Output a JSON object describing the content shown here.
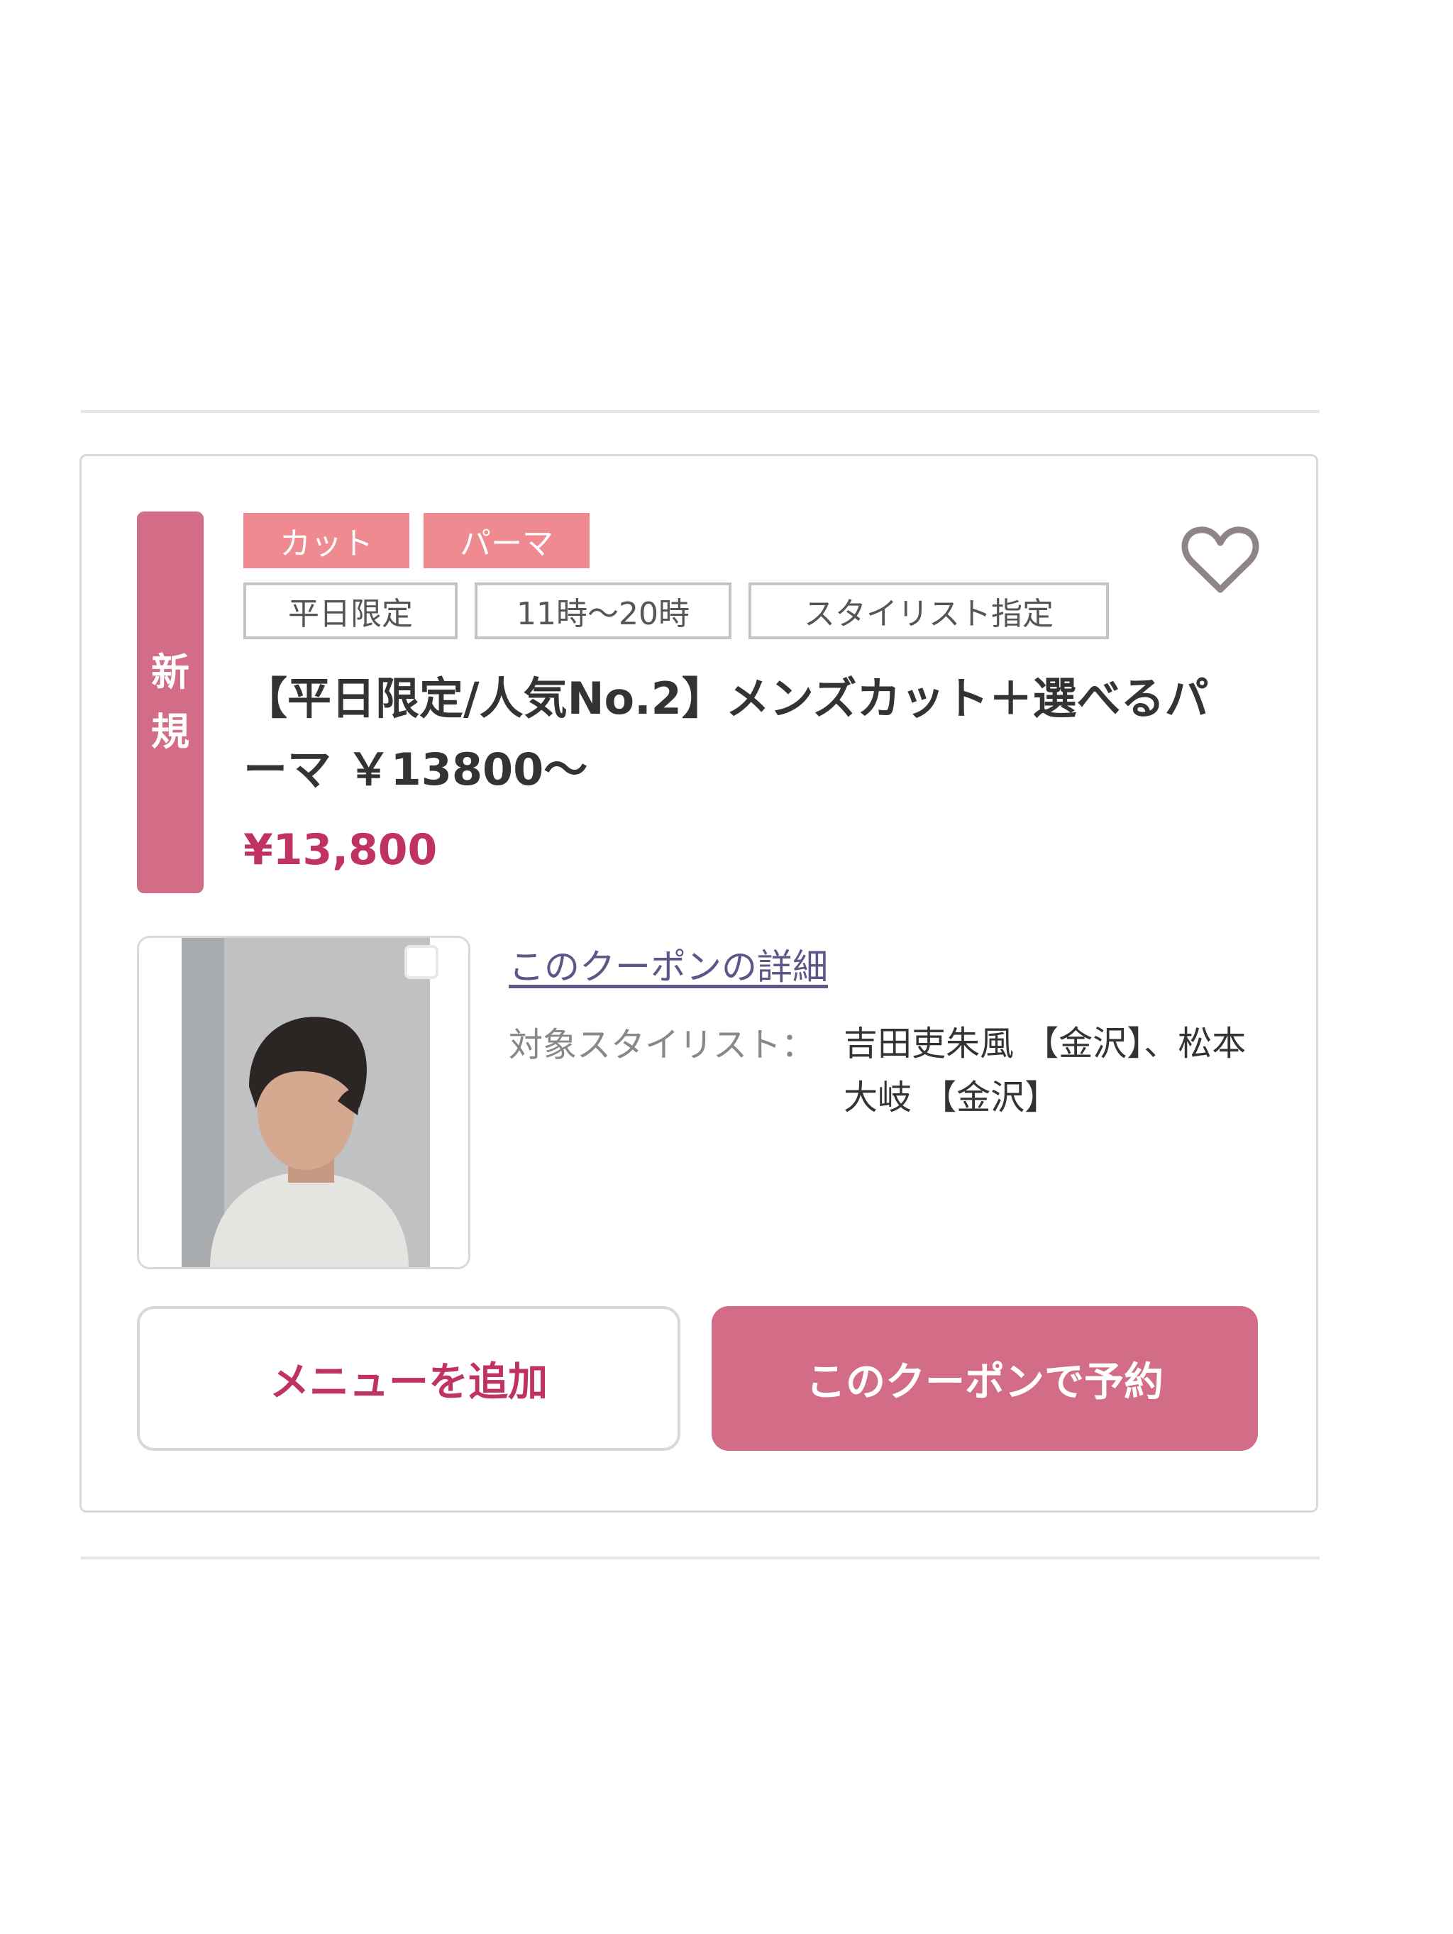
{
  "coupon": {
    "new_badge": "新規",
    "category_tags": [
      "カット",
      "パーマ"
    ],
    "condition_tags": [
      "平日限定",
      "11時〜20時",
      "スタイリスト指定"
    ],
    "title": "【平日限定/人気No.2】メンズカット＋選べるパーマ ￥13800〜",
    "price": "¥13,800",
    "detail_link": "このクーポンの詳細",
    "stylist_label": "対象スタイリスト：",
    "stylist_value": "吉田吏朱風 【金沢】、松本　大岐 【金沢】",
    "buttons": {
      "add_menu": "メニューを追加",
      "reserve": "このクーポンで予約"
    },
    "colors": {
      "accent": "#d36c86",
      "tag_fill": "#f08a91",
      "price": "#c0325f",
      "link": "#5b5887"
    },
    "icons": {
      "favorite": "heart-outline-icon"
    }
  }
}
